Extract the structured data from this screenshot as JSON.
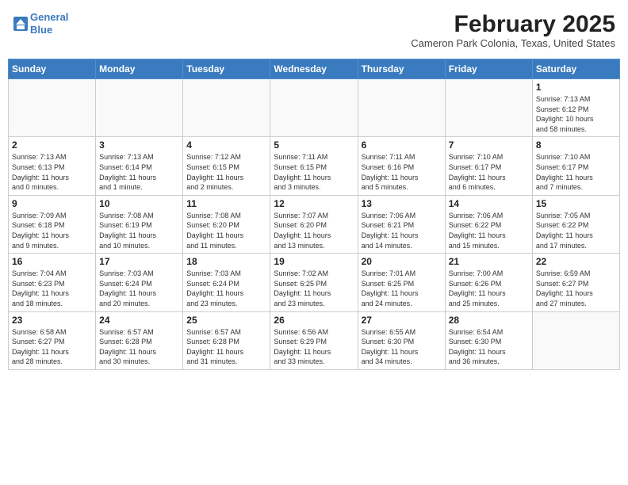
{
  "logo": {
    "line1": "General",
    "line2": "Blue"
  },
  "title": "February 2025",
  "subtitle": "Cameron Park Colonia, Texas, United States",
  "days_of_week": [
    "Sunday",
    "Monday",
    "Tuesday",
    "Wednesday",
    "Thursday",
    "Friday",
    "Saturday"
  ],
  "weeks": [
    [
      {
        "day": "",
        "info": ""
      },
      {
        "day": "",
        "info": ""
      },
      {
        "day": "",
        "info": ""
      },
      {
        "day": "",
        "info": ""
      },
      {
        "day": "",
        "info": ""
      },
      {
        "day": "",
        "info": ""
      },
      {
        "day": "1",
        "info": "Sunrise: 7:13 AM\nSunset: 6:12 PM\nDaylight: 10 hours\nand 58 minutes."
      }
    ],
    [
      {
        "day": "2",
        "info": "Sunrise: 7:13 AM\nSunset: 6:13 PM\nDaylight: 11 hours\nand 0 minutes."
      },
      {
        "day": "3",
        "info": "Sunrise: 7:13 AM\nSunset: 6:14 PM\nDaylight: 11 hours\nand 1 minute."
      },
      {
        "day": "4",
        "info": "Sunrise: 7:12 AM\nSunset: 6:15 PM\nDaylight: 11 hours\nand 2 minutes."
      },
      {
        "day": "5",
        "info": "Sunrise: 7:11 AM\nSunset: 6:15 PM\nDaylight: 11 hours\nand 3 minutes."
      },
      {
        "day": "6",
        "info": "Sunrise: 7:11 AM\nSunset: 6:16 PM\nDaylight: 11 hours\nand 5 minutes."
      },
      {
        "day": "7",
        "info": "Sunrise: 7:10 AM\nSunset: 6:17 PM\nDaylight: 11 hours\nand 6 minutes."
      },
      {
        "day": "8",
        "info": "Sunrise: 7:10 AM\nSunset: 6:17 PM\nDaylight: 11 hours\nand 7 minutes."
      }
    ],
    [
      {
        "day": "9",
        "info": "Sunrise: 7:09 AM\nSunset: 6:18 PM\nDaylight: 11 hours\nand 9 minutes."
      },
      {
        "day": "10",
        "info": "Sunrise: 7:08 AM\nSunset: 6:19 PM\nDaylight: 11 hours\nand 10 minutes."
      },
      {
        "day": "11",
        "info": "Sunrise: 7:08 AM\nSunset: 6:20 PM\nDaylight: 11 hours\nand 11 minutes."
      },
      {
        "day": "12",
        "info": "Sunrise: 7:07 AM\nSunset: 6:20 PM\nDaylight: 11 hours\nand 13 minutes."
      },
      {
        "day": "13",
        "info": "Sunrise: 7:06 AM\nSunset: 6:21 PM\nDaylight: 11 hours\nand 14 minutes."
      },
      {
        "day": "14",
        "info": "Sunrise: 7:06 AM\nSunset: 6:22 PM\nDaylight: 11 hours\nand 15 minutes."
      },
      {
        "day": "15",
        "info": "Sunrise: 7:05 AM\nSunset: 6:22 PM\nDaylight: 11 hours\nand 17 minutes."
      }
    ],
    [
      {
        "day": "16",
        "info": "Sunrise: 7:04 AM\nSunset: 6:23 PM\nDaylight: 11 hours\nand 18 minutes."
      },
      {
        "day": "17",
        "info": "Sunrise: 7:03 AM\nSunset: 6:24 PM\nDaylight: 11 hours\nand 20 minutes."
      },
      {
        "day": "18",
        "info": "Sunrise: 7:03 AM\nSunset: 6:24 PM\nDaylight: 11 hours\nand 23 minutes."
      },
      {
        "day": "19",
        "info": "Sunrise: 7:02 AM\nSunset: 6:25 PM\nDaylight: 11 hours\nand 23 minutes."
      },
      {
        "day": "20",
        "info": "Sunrise: 7:01 AM\nSunset: 6:25 PM\nDaylight: 11 hours\nand 24 minutes."
      },
      {
        "day": "21",
        "info": "Sunrise: 7:00 AM\nSunset: 6:26 PM\nDaylight: 11 hours\nand 25 minutes."
      },
      {
        "day": "22",
        "info": "Sunrise: 6:59 AM\nSunset: 6:27 PM\nDaylight: 11 hours\nand 27 minutes."
      }
    ],
    [
      {
        "day": "23",
        "info": "Sunrise: 6:58 AM\nSunset: 6:27 PM\nDaylight: 11 hours\nand 28 minutes."
      },
      {
        "day": "24",
        "info": "Sunrise: 6:57 AM\nSunset: 6:28 PM\nDaylight: 11 hours\nand 30 minutes."
      },
      {
        "day": "25",
        "info": "Sunrise: 6:57 AM\nSunset: 6:28 PM\nDaylight: 11 hours\nand 31 minutes."
      },
      {
        "day": "26",
        "info": "Sunrise: 6:56 AM\nSunset: 6:29 PM\nDaylight: 11 hours\nand 33 minutes."
      },
      {
        "day": "27",
        "info": "Sunrise: 6:55 AM\nSunset: 6:30 PM\nDaylight: 11 hours\nand 34 minutes."
      },
      {
        "day": "28",
        "info": "Sunrise: 6:54 AM\nSunset: 6:30 PM\nDaylight: 11 hours\nand 36 minutes."
      },
      {
        "day": "",
        "info": ""
      }
    ]
  ]
}
